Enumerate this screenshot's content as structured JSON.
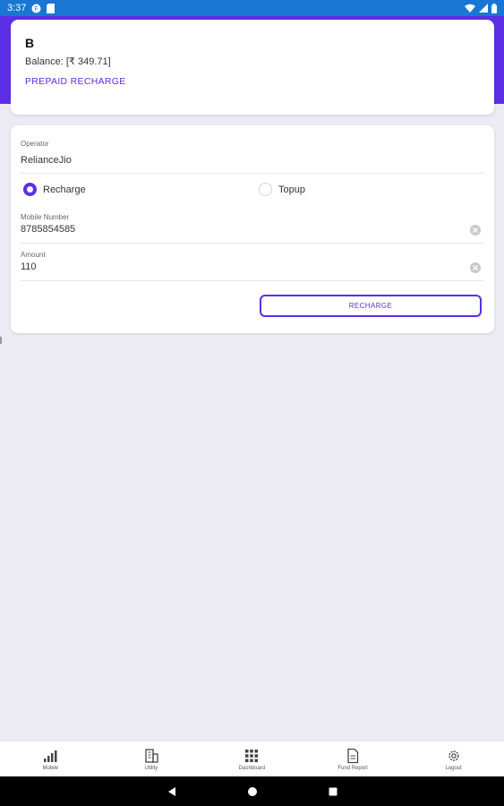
{
  "status_bar": {
    "time": "3:37"
  },
  "header": {
    "user_name": "B",
    "balance_text": "Balance: [₹ 349.71]",
    "section_label": "PREPAID RECHARGE"
  },
  "form": {
    "operator_label": "Operator",
    "operator_value": "RelianceJio",
    "recharge_option": "Recharge",
    "topup_option": "Topup",
    "selected_option": "Recharge",
    "mobile_label": "Mobile Number",
    "mobile_value": "8785854585",
    "amount_label": "Amount",
    "amount_value": "110",
    "submit_label": "RECHARGE"
  },
  "nav": {
    "items": [
      {
        "label": "Mobile",
        "icon": "signal-bars-icon"
      },
      {
        "label": "Utility",
        "icon": "building-icon"
      },
      {
        "label": "Dashboard",
        "icon": "grid-icon"
      },
      {
        "label": "Fund Report",
        "icon": "document-icon"
      },
      {
        "label": "Logout",
        "icon": "gear-icon"
      }
    ]
  },
  "colors": {
    "accent": "#5c2ee6",
    "status_bar": "#1976d2",
    "background": "#ecebf4"
  }
}
